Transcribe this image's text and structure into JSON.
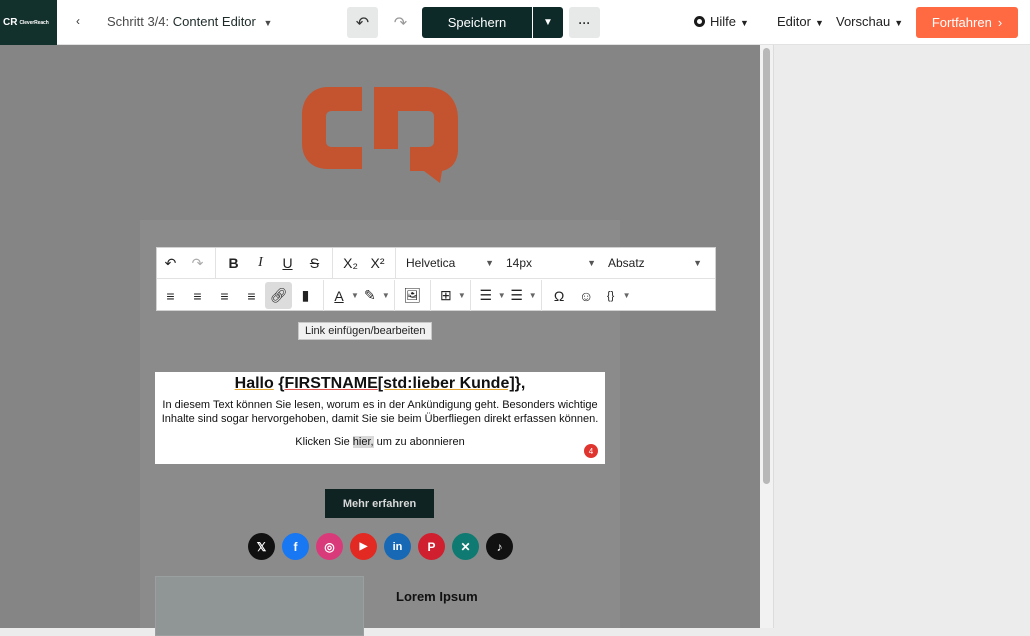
{
  "brand": {
    "name": "CleverReach",
    "mark": "CR"
  },
  "header": {
    "back_glyph": "‹",
    "step_prefix": "Schritt 3/4:",
    "step_title": "Content Editor",
    "undo_glyph": "↶",
    "redo_glyph": "↷",
    "save_label": "Speichern",
    "more_glyph": "···",
    "nav": {
      "help": "Hilfe",
      "editor": "Editor",
      "preview": "Vorschau"
    },
    "continue_label": "Fortfahren"
  },
  "toolbar": {
    "font_family": "Helvetica",
    "font_size": "14px",
    "block_format": "Absatz",
    "link_tooltip": "Link einfügen/bearbeiten",
    "tokens_glyph": "{}"
  },
  "content": {
    "greeting": "Hallo",
    "placeholder_open": "{",
    "placeholder_name": "FIRSTNAME",
    "placeholder_default": "[std:lieber Kunde]",
    "placeholder_close": "},",
    "body_line1": "In diesem Text können Sie lesen, worum es in der Ankündigung geht. Besonders wichtige",
    "body_line2": "Inhalte sind sogar hervorgehoben, damit Sie sie beim Überfliegen direkt erfassen können.",
    "link_pre": "Klicken Sie",
    "link_word": "hier,",
    "link_post": "um zu abonnieren",
    "badge_count": "4",
    "more_button": "Mehr erfahren",
    "lorem_heading": "Lorem Ipsum"
  },
  "socials": [
    {
      "name": "x",
      "glyph": "𝕏",
      "color": "#111111"
    },
    {
      "name": "facebook",
      "glyph": "f",
      "color": "#1877f2"
    },
    {
      "name": "instagram",
      "glyph": "◎",
      "color": "#d93b7a"
    },
    {
      "name": "youtube",
      "glyph": "▶",
      "color": "#e22a22"
    },
    {
      "name": "linkedin",
      "glyph": "in",
      "color": "#1769b5"
    },
    {
      "name": "pinterest",
      "glyph": "P",
      "color": "#d01f2f"
    },
    {
      "name": "xing",
      "glyph": "✕",
      "color": "#0f7a72"
    },
    {
      "name": "tiktok",
      "glyph": "♪",
      "color": "#111111"
    }
  ],
  "colors": {
    "accent": "#ff6a43",
    "dark": "#0d2a28",
    "logo": "#c44a2a"
  }
}
